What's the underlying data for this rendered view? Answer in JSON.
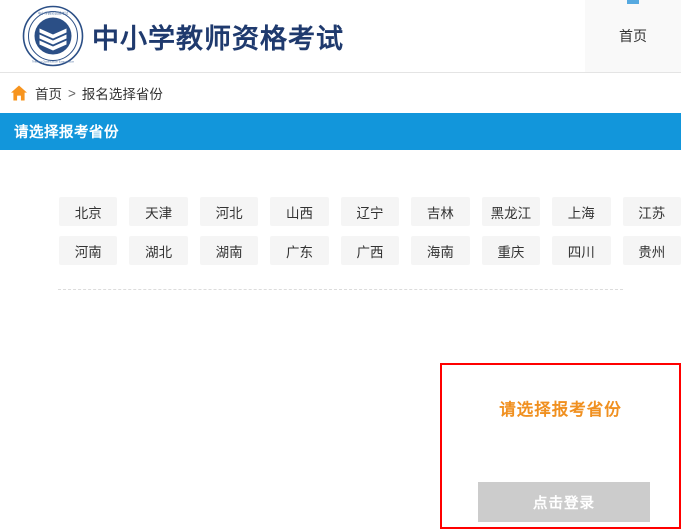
{
  "header": {
    "logo_icon": "exam-emblem-icon",
    "title": "中小学教师资格考试",
    "nav": {
      "home_label": "首页"
    },
    "brand_color": "#1f3a6e"
  },
  "breadcrumb": {
    "home_icon": "home-icon",
    "home_label": "首页",
    "separator": ">",
    "current_label": "报名选择省份"
  },
  "section": {
    "title": "请选择报考省份",
    "bar_color": "#1296db"
  },
  "provinces": {
    "rows": [
      [
        "北京",
        "天津",
        "河北",
        "山西",
        "辽宁",
        "吉林",
        "黑龙江",
        "上海",
        "江苏"
      ],
      [
        "河南",
        "湖北",
        "湖南",
        "广东",
        "广西",
        "海南",
        "重庆",
        "四川",
        "贵州"
      ]
    ]
  },
  "notice": {
    "message": "请选择报考省份",
    "message_color": "#f09020",
    "border_color": "#ff0000",
    "login_label": "点击登录",
    "login_bg": "#cccccc"
  }
}
